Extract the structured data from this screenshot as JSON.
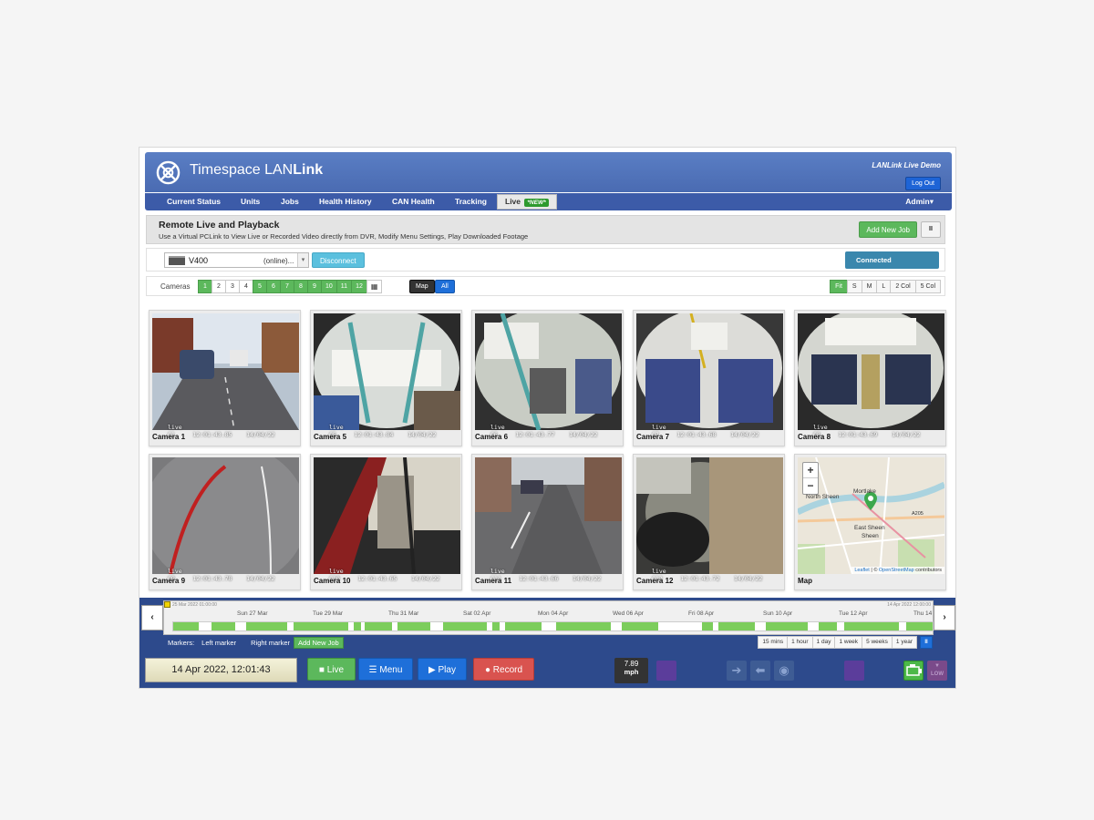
{
  "header": {
    "brand_regular": "Timespace LAN",
    "brand_bold": "Link",
    "demo_label": "LANLink Live Demo",
    "logout_label": "Log Out"
  },
  "nav": {
    "items": [
      {
        "label": "Current Status"
      },
      {
        "label": "Units"
      },
      {
        "label": "Jobs"
      },
      {
        "label": "Health History"
      },
      {
        "label": "CAN Health"
      },
      {
        "label": "Tracking"
      },
      {
        "label": "Live",
        "badge": "*NEW*"
      }
    ],
    "admin_label": "Admin▾"
  },
  "panel": {
    "title": "Remote Live and Playback",
    "subtitle": "Use a Virtual PCLink to View Live or Recorded Video directly from DVR, Modify Menu Settings, Play Downloaded Footage",
    "add_job_label": "Add New Job",
    "pause_label": "II"
  },
  "device": {
    "name": "V400",
    "status": "(online)...",
    "disconnect_label": "Disconnect",
    "connection_status": "Connected"
  },
  "camera_toolbar": {
    "label": "Cameras",
    "buttons": [
      "1",
      "2",
      "3",
      "4",
      "5",
      "6",
      "7",
      "8",
      "9",
      "10",
      "11",
      "12"
    ],
    "map_label": "Map",
    "all_label": "All",
    "sizes": [
      "Fit",
      "S",
      "M",
      "L",
      "2 Col",
      "5 Col"
    ]
  },
  "cameras": [
    {
      "name": "Camera 1",
      "osd_id": "C1",
      "osd_time": "12:01:43.85",
      "osd_date": "14/04/22"
    },
    {
      "name": "Camera 5",
      "osd_id": "C5",
      "osd_time": "12:01:43.84",
      "osd_date": "14/04/22"
    },
    {
      "name": "Camera 6",
      "osd_id": "C6",
      "osd_time": "12:01:43.77",
      "osd_date": "14/04/22"
    },
    {
      "name": "Camera 7",
      "osd_id": "C7",
      "osd_time": "12:01:43.68",
      "osd_date": "14/04/22"
    },
    {
      "name": "Camera 8",
      "osd_id": "C8",
      "osd_time": "12:01:43.69",
      "osd_date": "14/04/22"
    },
    {
      "name": "Camera 9",
      "osd_id": "C9",
      "osd_time": "12:01:43.78",
      "osd_date": "14/04/22"
    },
    {
      "name": "Camera 10",
      "osd_id": "C10",
      "osd_time": "12:01:43.65",
      "osd_date": "14/04/22"
    },
    {
      "name": "Camera 11",
      "osd_id": "C11",
      "osd_time": "12:01:43.66",
      "osd_date": "14/04/22"
    },
    {
      "name": "Camera 12",
      "osd_id": "C12",
      "osd_time": "12:01:43.72",
      "osd_date": "14/04/22"
    }
  ],
  "osd_live": "live",
  "map": {
    "name": "Map",
    "zoom_in": "+",
    "zoom_out": "−",
    "labels": [
      "Mortlake",
      "North Sheen",
      "East Sheen",
      "Sheen",
      "A205"
    ],
    "attribution_leaflet": "Leaflet",
    "attribution_sep": " | © ",
    "attribution_osm": "OpenStreetMap",
    "attribution_rest": " contributors"
  },
  "timeline": {
    "left_edge": "25 Mar 2022 01:00:00",
    "right_edge": "14 Apr 2022 12:00:00",
    "dates": [
      "Sun 27 Mar",
      "Tue 29 Mar",
      "Thu 31 Mar",
      "Sat 02 Apr",
      "Mon 04 Apr",
      "Wed 06 Apr",
      "Fri 08 Apr",
      "Sun 10 Apr",
      "Tue 12 Apr",
      "Thu 14"
    ],
    "prev_label": "‹",
    "next_label": "›",
    "markers_label": "Markers:",
    "left_marker_label": "Left marker",
    "right_marker_label": "Right marker",
    "add_job_label": "Add New Job",
    "ranges": [
      "15 mins",
      "1 hour",
      "1 day",
      "1 week",
      "5 weeks",
      "1 year"
    ],
    "range_pause": "II"
  },
  "controls": {
    "datetime": "14 Apr 2022, 12:01:43",
    "live_label": "Live",
    "menu_label": "Menu",
    "play_label": "Play",
    "record_label": "Record",
    "speed_value": "7.89",
    "speed_unit": "mph",
    "low_label": "LOW"
  }
}
